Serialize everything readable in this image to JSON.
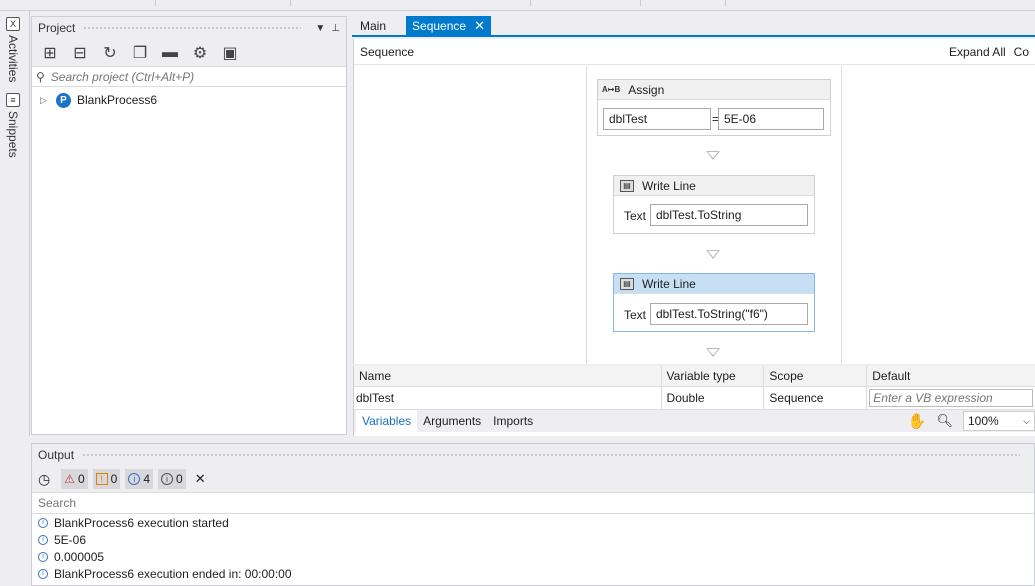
{
  "sidestrip": {
    "activities": "Activities",
    "snippets": "Snippets"
  },
  "project": {
    "title": "Project",
    "search_placeholder": "Search project (Ctrl+Alt+P)",
    "tree_root": "BlankProcess6"
  },
  "tabs": [
    {
      "label": "Main"
    },
    {
      "label": "Sequence"
    }
  ],
  "designer": {
    "breadcrumb": "Sequence",
    "expand_all": "Expand All",
    "collapse_all_partial": "Co",
    "assign": {
      "title": "Assign",
      "to": "dblTest",
      "eq": "=",
      "value": "5E-06"
    },
    "writeline1": {
      "title": "Write Line",
      "label": "Text",
      "value": "dblTest.ToString"
    },
    "writeline2": {
      "title": "Write Line",
      "label": "Text",
      "value": "dblTest.ToString(\"f6\")"
    }
  },
  "variables": {
    "headers": [
      "Name",
      "Variable type",
      "Scope",
      "Default"
    ],
    "row": {
      "name": "dblTest",
      "type": "Double",
      "scope": "Sequence",
      "default_placeholder": "Enter a VB expression"
    },
    "tabs": [
      "Variables",
      "Arguments",
      "Imports"
    ],
    "zoom": "100%"
  },
  "output": {
    "title": "Output",
    "counts": {
      "errors": "0",
      "warnings": "0",
      "info": "4",
      "trace": "0"
    },
    "search_placeholder": "Search",
    "lines": [
      "BlankProcess6 execution started",
      "5E-06",
      "0.000005",
      "BlankProcess6 execution ended in: 00:00:00"
    ]
  }
}
